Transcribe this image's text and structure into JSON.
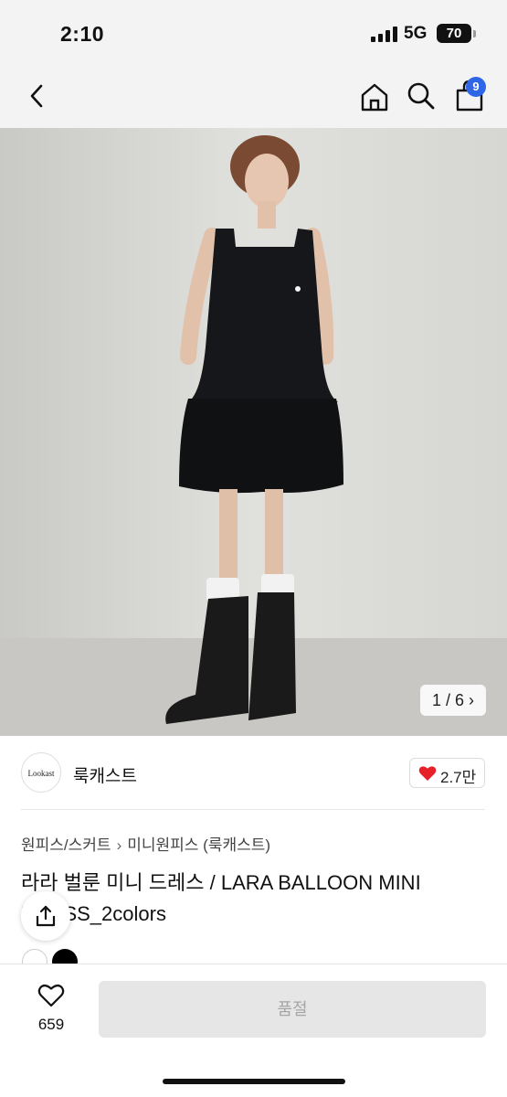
{
  "status_bar": {
    "time": "2:10",
    "network": "5G",
    "battery": "70"
  },
  "nav": {
    "back_icon": "chevron-left-icon",
    "home_icon": "home-icon",
    "search_icon": "search-icon",
    "cart_icon": "shopping-bag-icon",
    "cart_badge": "9",
    "badge_color": "#2f66e8"
  },
  "gallery": {
    "counter": "1 / 6 ›",
    "current": 1,
    "total": 6
  },
  "shop": {
    "logo_text": "Lookast",
    "name": "룩캐스트",
    "likes": "2.7만"
  },
  "breadcrumb": {
    "category": "원피스/스커트",
    "separator": "›",
    "subcategory": "미니원피스 (룩캐스트)"
  },
  "product": {
    "title": "라라 벌룬 미니 드레스 / LARA BALLOON MINI DRESS_2colors",
    "colors": [
      "#ffffff",
      "#000000"
    ]
  },
  "bottom_bar": {
    "wish_count": "659",
    "buy_label": "품절"
  },
  "colors": {
    "like_heart": "#e8202a",
    "disabled_button": "#e6e6e6",
    "disabled_text": "#a6a6a6"
  }
}
